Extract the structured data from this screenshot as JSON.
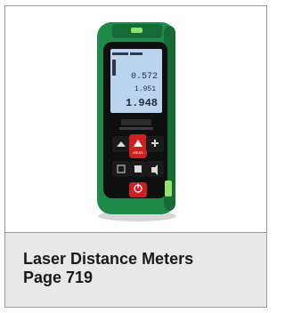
{
  "product": {
    "title": "Laser Distance Meters",
    "page": "Page 719",
    "image_alt": "laser-distance-meter",
    "display": {
      "line1": "0.572",
      "line2": "1.951",
      "line3": "1.948"
    },
    "buttons": {
      "measure": "MEAS"
    },
    "colors": {
      "body_green": "#1f8a4a",
      "display_blue": "#b9d4ec",
      "button_red": "#d11f1f",
      "button_black": "#1b1b1b",
      "caption_bg": "#e8e8e8"
    }
  }
}
